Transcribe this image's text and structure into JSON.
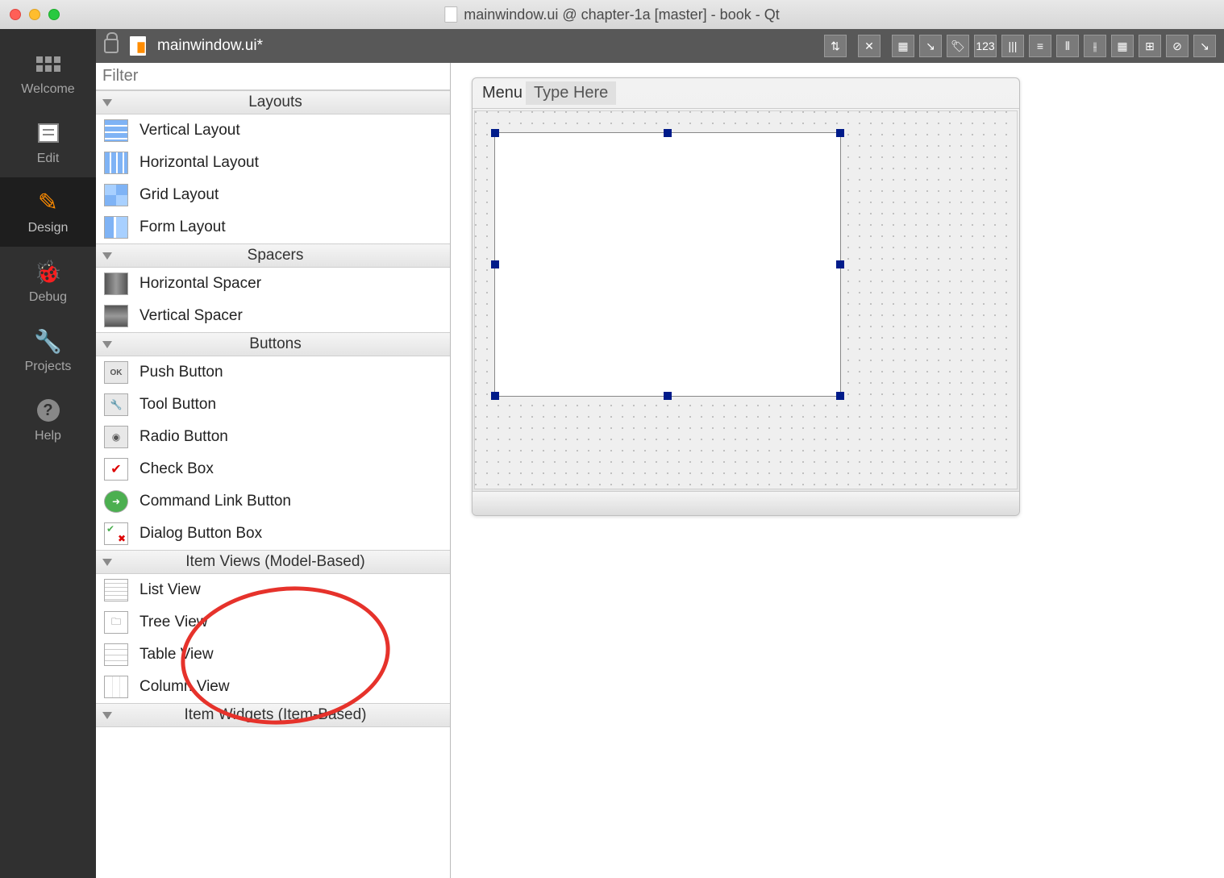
{
  "window_title": "mainwindow.ui @ chapter-1a [master] - book - Qt",
  "toolbar": {
    "file_label": "mainwindow.ui*"
  },
  "modes": {
    "welcome": "Welcome",
    "edit": "Edit",
    "design": "Design",
    "debug": "Debug",
    "projects": "Projects",
    "help": "Help"
  },
  "widgetbox": {
    "filter_placeholder": "Filter",
    "categories": [
      {
        "title": "Layouts",
        "items": [
          {
            "label": "Vertical Layout",
            "icon": "vlayout"
          },
          {
            "label": "Horizontal Layout",
            "icon": "hlayout"
          },
          {
            "label": "Grid Layout",
            "icon": "grid"
          },
          {
            "label": "Form Layout",
            "icon": "form"
          }
        ]
      },
      {
        "title": "Spacers",
        "items": [
          {
            "label": "Horizontal Spacer",
            "icon": "hspacer"
          },
          {
            "label": "Vertical Spacer",
            "icon": "vspacer"
          }
        ]
      },
      {
        "title": "Buttons",
        "items": [
          {
            "label": "Push Button",
            "icon": "push"
          },
          {
            "label": "Tool Button",
            "icon": "tool"
          },
          {
            "label": "Radio Button",
            "icon": "radio"
          },
          {
            "label": "Check Box",
            "icon": "check"
          },
          {
            "label": "Command Link Button",
            "icon": "cmd"
          },
          {
            "label": "Dialog Button Box",
            "icon": "dlgbox"
          }
        ]
      },
      {
        "title": "Item Views (Model-Based)",
        "items": [
          {
            "label": "List View",
            "icon": "list"
          },
          {
            "label": "Tree View",
            "icon": "tree"
          },
          {
            "label": "Table View",
            "icon": "table"
          },
          {
            "label": "Column View",
            "icon": "column"
          }
        ]
      },
      {
        "title": "Item Widgets (Item-Based)",
        "items": []
      }
    ]
  },
  "form": {
    "menu_label": "Menu",
    "type_here": "Type Here"
  }
}
